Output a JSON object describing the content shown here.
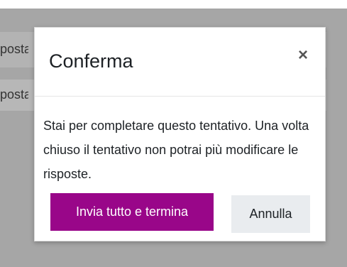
{
  "background": {
    "row1_text": "posta",
    "row2_text": "posta"
  },
  "modal": {
    "title": "Conferma",
    "close_glyph": "×",
    "body_text": "Stai per completare questo tentativo. Una volta chiuso il tentativo non potrai più modificare le risposte.",
    "primary_button": "Invia tutto e termina",
    "secondary_button": "Annulla"
  },
  "colors": {
    "primary_button_bg": "#990689",
    "secondary_button_bg": "#e9ecef",
    "overlay": "#a6a6a6"
  },
  "icons": {
    "close": "close-icon"
  }
}
